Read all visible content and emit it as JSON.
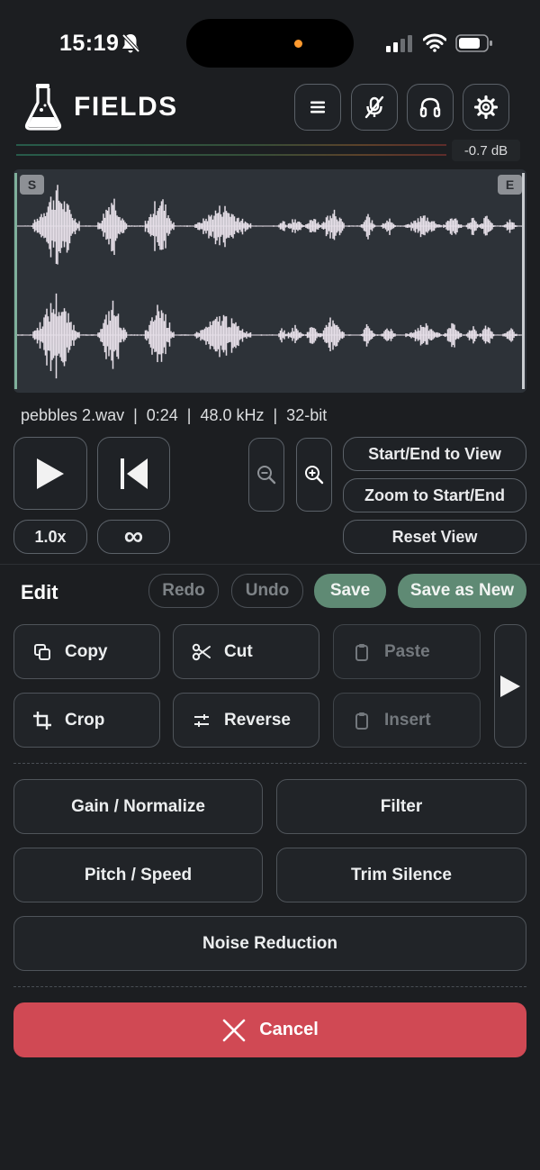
{
  "status_bar": {
    "time": "15:19",
    "icons": [
      "bell-slash-icon",
      "signal-icon",
      "wifi-icon",
      "battery-icon"
    ]
  },
  "header": {
    "title": "FIELDS",
    "buttons": [
      "menu-icon",
      "mic-off-icon",
      "headphones-icon",
      "settings-icon"
    ]
  },
  "meter": {
    "readout": "-0.7 dB"
  },
  "waveform": {
    "start_marker": "S",
    "end_marker": "E"
  },
  "file_info": "pebbles 2.wav  |  0:24  |  48.0 kHz  |  32-bit",
  "transport": {
    "speed": "1.0x",
    "loop": "∞",
    "start_end_to_view": "Start/End to View",
    "zoom_to_start_end": "Zoom to Start/End",
    "reset_view": "Reset View"
  },
  "edit": {
    "label": "Edit",
    "redo": "Redo",
    "undo": "Undo",
    "save": "Save",
    "save_as_new": "Save as New",
    "tools": {
      "copy": "Copy",
      "cut": "Cut",
      "paste": "Paste",
      "crop": "Crop",
      "reverse": "Reverse",
      "insert": "Insert"
    },
    "effects": {
      "gain": "Gain / Normalize",
      "filter": "Filter",
      "pitch": "Pitch / Speed",
      "trim": "Trim Silence",
      "noise": "Noise Reduction"
    },
    "cancel": "Cancel"
  },
  "colors": {
    "background": "#1c1e21",
    "accent_green": "#5f8a74",
    "cancel_red": "#d04954",
    "waveform": "#e6dfe8"
  }
}
